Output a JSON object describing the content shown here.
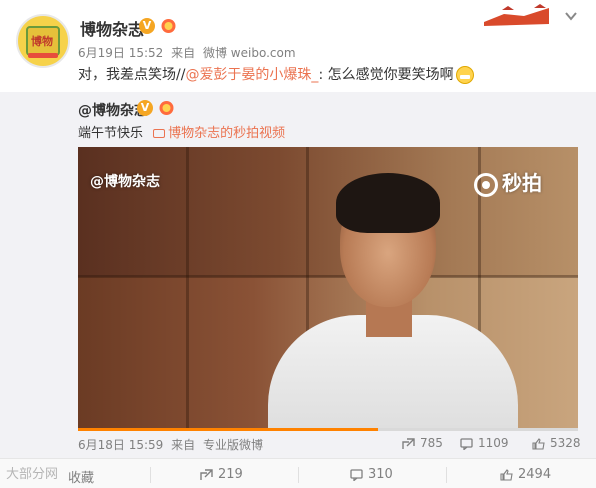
{
  "post": {
    "author": "博物杂志",
    "date": "6月19日 15:52",
    "source_prefix": "来自",
    "source": "微博 weibo.com",
    "text_before": "对，我差点笑场//",
    "mention": "@爱彭于晏的小爆珠_",
    "text_after": ":  怎么感觉你要笑场啊"
  },
  "repost": {
    "author": "@博物杂志",
    "text": "端午节快乐",
    "video_link": "博物杂志的秒拍视频",
    "video_watermark": "@博物杂志",
    "video_brand": "秒拍",
    "progress": 0.6,
    "date": "6月18日 15:59",
    "source_prefix": "来自",
    "source": "专业版微博",
    "reposts": "785",
    "comments": "1109",
    "likes": "5328"
  },
  "footer": {
    "collect": "收藏",
    "reposts": "219",
    "comments": "310",
    "likes": "2494"
  },
  "watermark": "大部分网",
  "colors": {
    "mention": "#eb7350",
    "verified": "#f5a623",
    "progress": "#ff8200"
  }
}
